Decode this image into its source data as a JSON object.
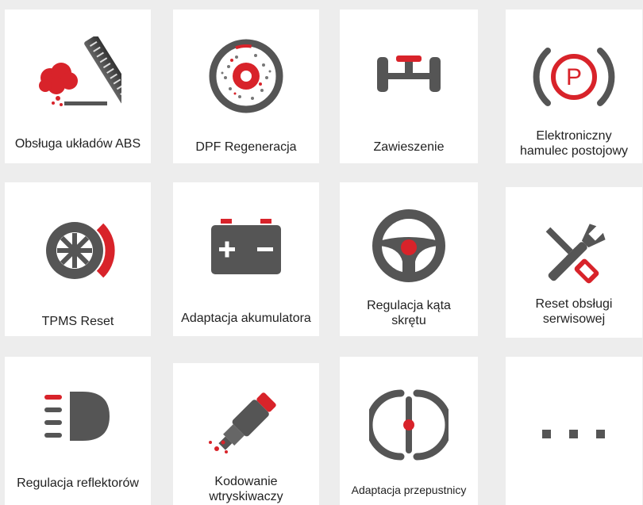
{
  "tiles": [
    {
      "label": "Obsługa układów ABS"
    },
    {
      "label": "DPF Regeneracja"
    },
    {
      "label": "Zawieszenie"
    },
    {
      "label": "Elektroniczny\nhamulec postojowy"
    },
    {
      "label": "TPMS Reset"
    },
    {
      "label": "Adaptacja akumulatora"
    },
    {
      "label": "Regulacja kąta\nskrętu"
    },
    {
      "label": "Reset obsługi\nserwisowej"
    },
    {
      "label": "Regulacja reflektorów"
    },
    {
      "label": "Kodowanie\nwtryskiwaczy"
    },
    {
      "label": "Adaptacja przepustnicy"
    },
    {
      "label": ""
    }
  ],
  "icons": {
    "red": "#d8232a",
    "gray": "#4a4a4a",
    "epb_letter": "P"
  }
}
